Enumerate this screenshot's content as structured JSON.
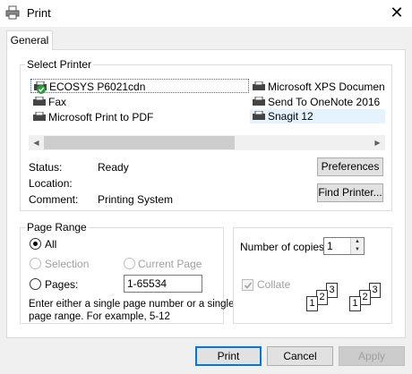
{
  "window": {
    "title": "Print",
    "close_symbol": "✕"
  },
  "tabs": [
    {
      "label": "General"
    }
  ],
  "select_printer": {
    "group_label": "Select Printer",
    "printers": [
      {
        "name": "ECOSYS P6021cdn"
      },
      {
        "name": "Fax"
      },
      {
        "name": "Microsoft Print to PDF"
      },
      {
        "name": "Microsoft XPS Documen"
      },
      {
        "name": "Send To OneNote 2016"
      },
      {
        "name": "Snagit 12"
      }
    ],
    "status_label": "Status:",
    "status_value": "Ready",
    "location_label": "Location:",
    "location_value": "",
    "comment_label": "Comment:",
    "comment_value": "Printing System",
    "preferences_button": "Preferences",
    "find_printer_button": "Find Printer..."
  },
  "page_range": {
    "group_label": "Page Range",
    "all_label": "All",
    "selection_label": "Selection",
    "current_page_label": "Current Page",
    "pages_label": "Pages:",
    "pages_value": "1-65534",
    "hint_line1": "Enter either a single page number or a single",
    "hint_line2": "page range.  For example, 5-12"
  },
  "copies": {
    "number_label": "Number of copies:",
    "number_value": "1",
    "collate_label": "Collate",
    "collate_pages": [
      "1",
      "2",
      "3",
      "1",
      "2",
      "3"
    ]
  },
  "footer": {
    "print_button": "Print",
    "cancel_button": "Cancel",
    "apply_button": "Apply"
  }
}
